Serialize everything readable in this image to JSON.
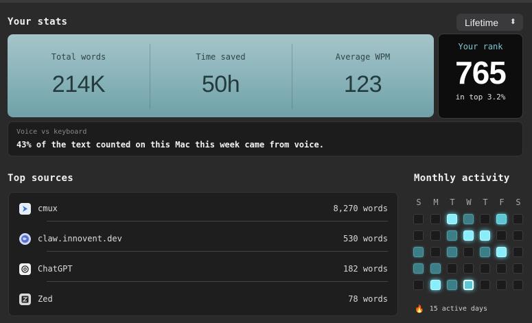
{
  "header": {
    "title": "Your stats",
    "range": "Lifetime"
  },
  "stats": [
    {
      "label": "Total words",
      "value": "214K"
    },
    {
      "label": "Time saved",
      "value": "50h"
    },
    {
      "label": "Average WPM",
      "value": "123"
    }
  ],
  "rank": {
    "label": "Your rank",
    "value": "765",
    "sub": "in top 3.2%"
  },
  "voice": {
    "label": "Voice vs keyboard",
    "text": "43% of the text counted on this Mac this week came from voice."
  },
  "sources": {
    "title": "Top sources",
    "items": [
      {
        "name": "cmux",
        "count": "8,270 words",
        "icon": "cmux-icon"
      },
      {
        "name": "claw.innovent.dev",
        "count": "530 words",
        "icon": "globe-icon"
      },
      {
        "name": "ChatGPT",
        "count": "182 words",
        "icon": "chatgpt-icon"
      },
      {
        "name": "Zed",
        "count": "78 words",
        "icon": "zed-icon"
      }
    ]
  },
  "activity": {
    "title": "Monthly activity",
    "weekdays": [
      "S",
      "M",
      "T",
      "W",
      "T",
      "F",
      "S"
    ],
    "grid": [
      [
        "none",
        "none",
        "high",
        "low",
        "none",
        "mid",
        "none"
      ],
      [
        "none",
        "none",
        "low",
        "high",
        "high",
        "none",
        "none"
      ],
      [
        "low",
        "none",
        "low",
        "none",
        "low",
        "high",
        "none"
      ],
      [
        "low",
        "low",
        "none",
        "none",
        "none",
        "none",
        "none"
      ],
      [
        "none",
        "high",
        "low",
        "today",
        "none",
        "none",
        "none"
      ]
    ],
    "active_days": "15 active days"
  }
}
